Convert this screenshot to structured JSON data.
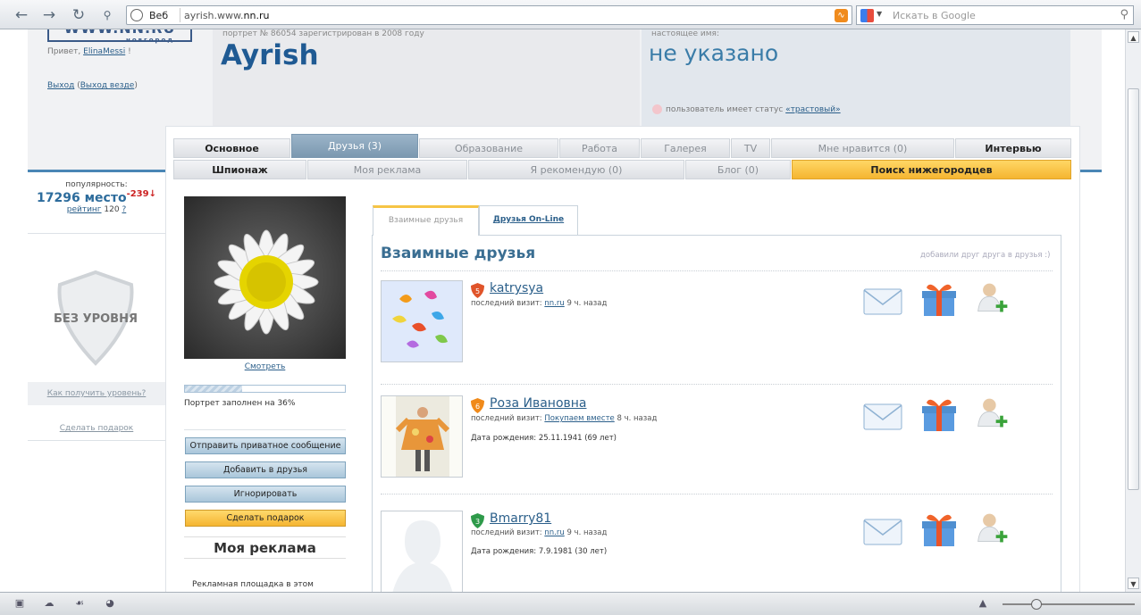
{
  "browser": {
    "web_label": "Веб",
    "url_prefix": "ayrish.www.",
    "url_domain": "nn.ru",
    "search_placeholder": "Искать в Google"
  },
  "header": {
    "logo_text": "WWW.NN.RU",
    "logo_sub": "новгород",
    "greeting": "Привет,",
    "username": "ElinaMessi",
    "greeting_end": "!",
    "logout": "Выход",
    "logout_all": "Выход везде",
    "portrait_info": "портрет № 86054 зарегистрирован в 2008 году",
    "nickname": "Ayrish",
    "realname_label": "настоящее имя:",
    "realname": "не указано",
    "status_text": "пользователь имеет статус",
    "status_value": "«трастовый»"
  },
  "sidebar": {
    "popularity_label": "популярность:",
    "place": "17296 место",
    "delta": "-239↓",
    "rating_label": "рейтинг",
    "rating_value": "120",
    "rating_help": "?",
    "level_badge": "БЕЗ УРОВНЯ",
    "how_level": "Как получить уровень?",
    "make_gift": "Сделать подарок"
  },
  "tabs_row1": [
    "Основное",
    "Друзья (3)",
    "Образование",
    "Работа",
    "Галерея",
    "TV",
    "Мне нравится (0)",
    "Интервью"
  ],
  "tabs_row2": [
    "Шпионаж",
    "Моя реклама",
    "Я рекомендую (0)",
    "Блог (0)",
    "Поиск нижегородцев"
  ],
  "profile": {
    "see_link": "Смотреть",
    "progress_percent": 36,
    "progress_text": "Портрет заполнен на 36%",
    "buttons": [
      "Отправить приватное сообщение",
      "Добавить в друзья",
      "Игнорировать",
      "Сделать подарок"
    ],
    "my_ad_title": "Моя реклама",
    "my_ad_text": "Рекламная площадка в этом"
  },
  "friends": {
    "tab_mutual": "Взаимные друзья",
    "tab_online": "Друзья On-Line",
    "title": "Взаимные друзья",
    "note": "добавили друг друга в друзья :)",
    "visit_label": "последний визит:",
    "bday_label": "Дата рождения:",
    "list": [
      {
        "name": "katrysya",
        "level": "5",
        "level_color": "#e0542a",
        "visit_site": "nn.ru",
        "visit_time": "9 ч. назад",
        "bday": ""
      },
      {
        "name": "Роза Ивановна",
        "level": "6",
        "level_color": "#f08a1a",
        "visit_site": "Покупаем вместе",
        "visit_time": "8 ч. назад",
        "bday": "25.11.1941 (69 лет)"
      },
      {
        "name": "Bmarry81",
        "level": "3",
        "level_color": "#2e9a4a",
        "visit_site": "nn.ru",
        "visit_time": "9 ч. назад",
        "bday": "7.9.1981 (30 лет)"
      }
    ]
  }
}
